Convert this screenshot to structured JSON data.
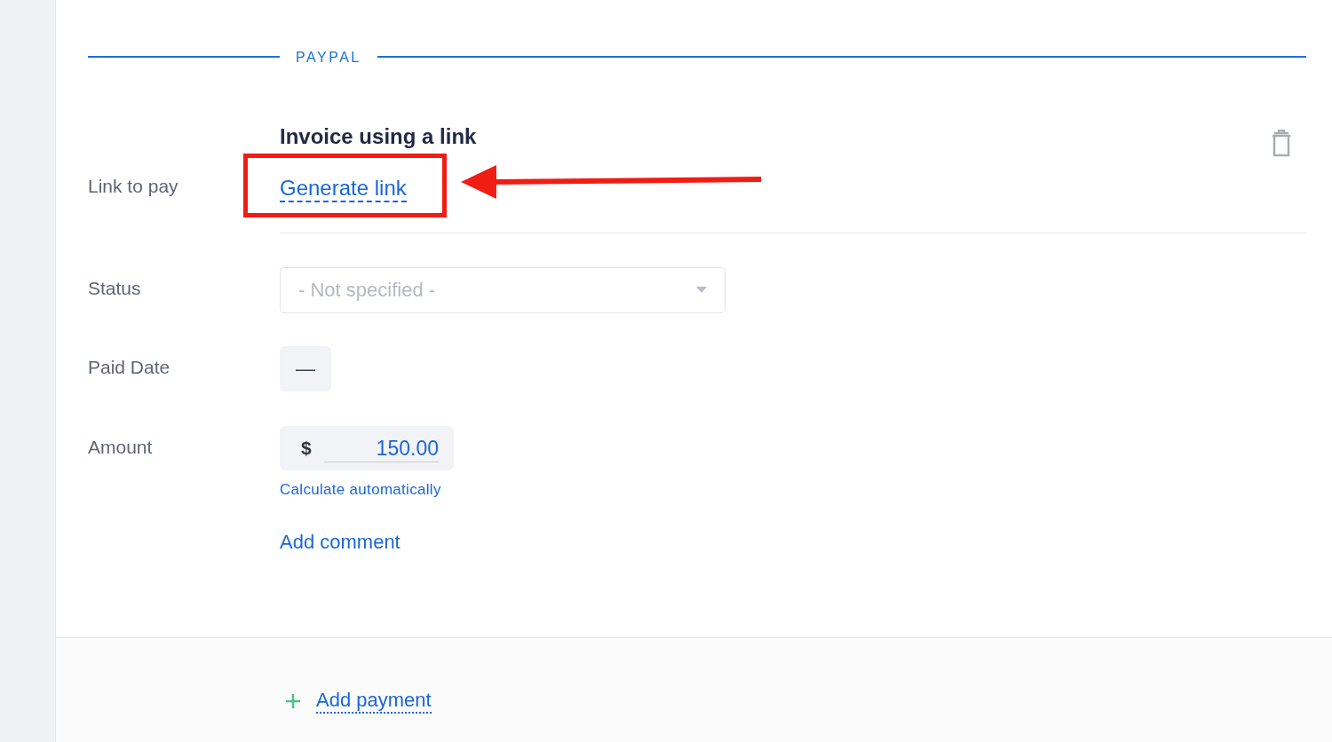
{
  "section": {
    "title": "PAYPAL"
  },
  "heading": "Invoice using a link",
  "link_to_pay": {
    "label": "Link to pay",
    "action": "Generate link"
  },
  "status": {
    "label": "Status",
    "placeholder": "- Not specified -"
  },
  "paid_date": {
    "label": "Paid Date",
    "value": "—"
  },
  "amount": {
    "label": "Amount",
    "currency": "$",
    "value": "150.00",
    "hint": "Calculate automatically"
  },
  "add_comment": "Add comment",
  "add_payment": "Add payment"
}
